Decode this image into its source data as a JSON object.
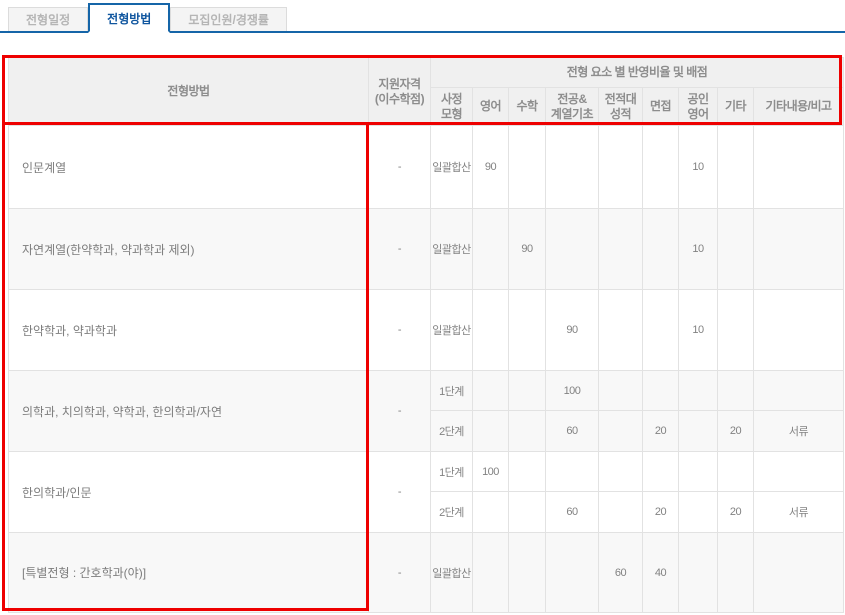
{
  "tabs": [
    {
      "label": "전형일정",
      "active": false
    },
    {
      "label": "전형방법",
      "active": true
    },
    {
      "label": "모집인원/경쟁률",
      "active": false
    }
  ],
  "colors": {
    "accent_blue": "#1565a8",
    "active_tab_text": "#10569f",
    "annotation_red": "#ee0000",
    "header_bg": "#f0f0f0",
    "alt_row_bg": "#f8f8f8",
    "border": "#e2e2e2"
  },
  "table": {
    "header": {
      "method": "전형방법",
      "qualification": "지원자격\n(이수학점)",
      "group": "전형 요소 별 반영비율 및 배점",
      "columns": [
        "사정\n모형",
        "영어",
        "수학",
        "전공&\n계열기초",
        "전적대\n성적",
        "면접",
        "공인\n영어",
        "기타",
        "기타내용/비고"
      ]
    },
    "rows": [
      {
        "name": "인문계열",
        "qual": "-",
        "model": "일괄합산",
        "eng": "90",
        "cert": "10"
      },
      {
        "name": "자연계열(한약학과, 약과학과 제외)",
        "qual": "-",
        "model": "일괄합산",
        "math": "90",
        "cert": "10"
      },
      {
        "name": "한약학과, 약과학과",
        "qual": "-",
        "model": "일괄합산",
        "major": "90",
        "cert": "10"
      },
      {
        "name": "의학과, 치의학과, 약학과, 한의학과/자연",
        "qual": "-",
        "s1": {
          "model": "1단계",
          "major": "100"
        },
        "s2": {
          "model": "2단계",
          "major": "60",
          "interview": "20",
          "etc": "20",
          "note": "서류"
        }
      },
      {
        "name": "한의학과/인문",
        "qual": "-",
        "s1": {
          "model": "1단계",
          "eng": "100"
        },
        "s2": {
          "model": "2단계",
          "major": "60",
          "interview": "20",
          "etc": "20",
          "note": "서류"
        }
      },
      {
        "name": "[특별전형 : 간호학과(야)]",
        "qual": "-",
        "model": "일괄합산",
        "prev": "60",
        "interview": "40"
      }
    ]
  }
}
